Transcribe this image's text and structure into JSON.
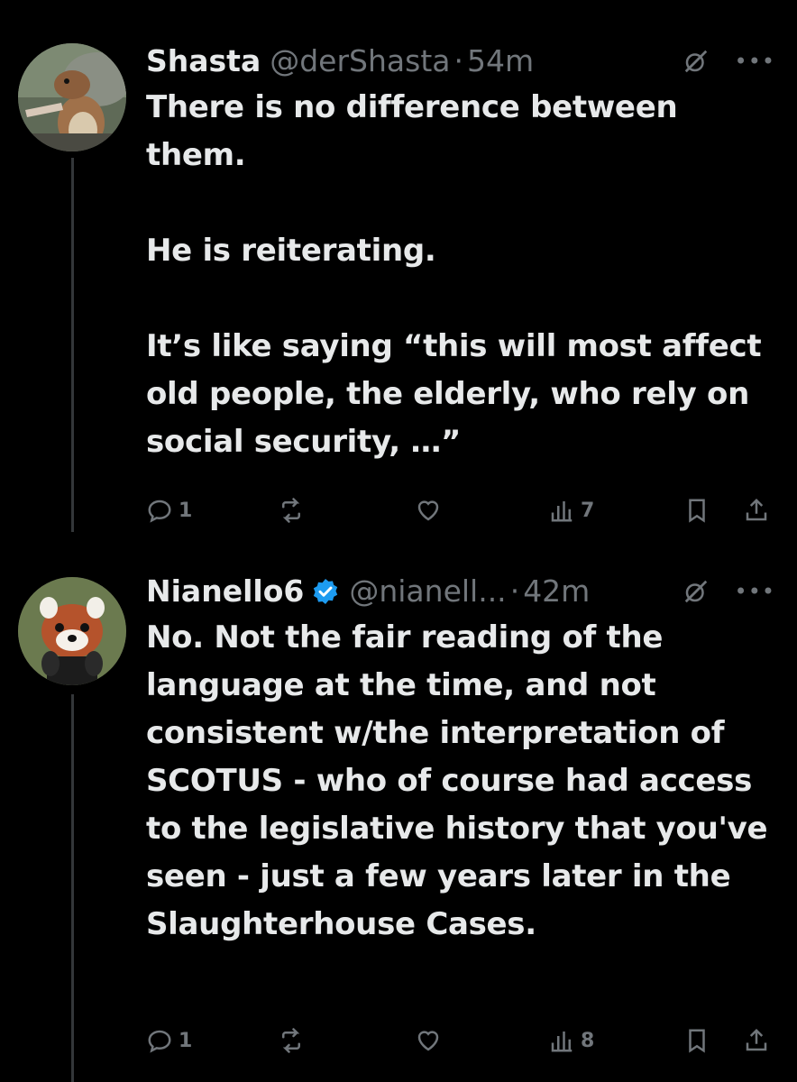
{
  "tweets": [
    {
      "name": "Shasta",
      "handle": "@derShasta",
      "time": "54m",
      "verified": false,
      "text": "There is no difference between them.\n\nHe is reiterating.\n\nIt’s like saying “this will most affect old people, the elderly, who rely on social security, …”",
      "replies": "1",
      "views": "7",
      "avatar": "squirrel-avatar"
    },
    {
      "name": "Nianello6",
      "handle": "@nianell...",
      "time": "42m",
      "verified": true,
      "text": "No. Not the fair reading of the language at the time, and not consistent w/the interpretation of SCOTUS - who of course had access to the legislative history that you've seen - just a few years later in the Slaughterhouse Cases.",
      "replies": "1",
      "views": "8",
      "avatar": "red-panda-avatar"
    }
  ],
  "separator": "·",
  "more_label": "•••",
  "colors": {
    "background": "#000000",
    "text": "#e7e9ea",
    "muted": "#71767b",
    "verified": "#1d9bf0"
  }
}
